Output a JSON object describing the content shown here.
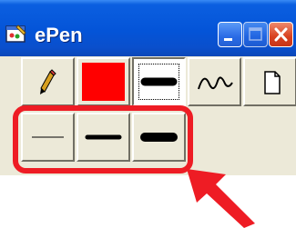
{
  "window": {
    "title": "ePen",
    "icons": {
      "app": "paint-window-icon",
      "minimize": "minimize-icon",
      "maximize": "maximize-icon",
      "close": "close-icon"
    }
  },
  "toolbar": {
    "tools": [
      {
        "name": "pencil-tool",
        "icon": "pencil-icon"
      },
      {
        "name": "color-picker",
        "icon": "color-swatch",
        "color": "#ff0000"
      },
      {
        "name": "line-width-selector",
        "icon": "thick-line-icon",
        "pressed": true
      },
      {
        "name": "freehand-tool",
        "icon": "squiggle-icon"
      },
      {
        "name": "new-page-tool",
        "icon": "blank-page-icon"
      }
    ]
  },
  "line_widths": {
    "options": [
      {
        "name": "thin",
        "icon": "thin-line-icon"
      },
      {
        "name": "medium",
        "icon": "medium-line-icon"
      },
      {
        "name": "thick",
        "icon": "thick-line-icon"
      }
    ]
  },
  "annotation": {
    "color": "#ee1c24",
    "frame": "highlight-frame",
    "pointer": "arrow-pointer-icon"
  }
}
